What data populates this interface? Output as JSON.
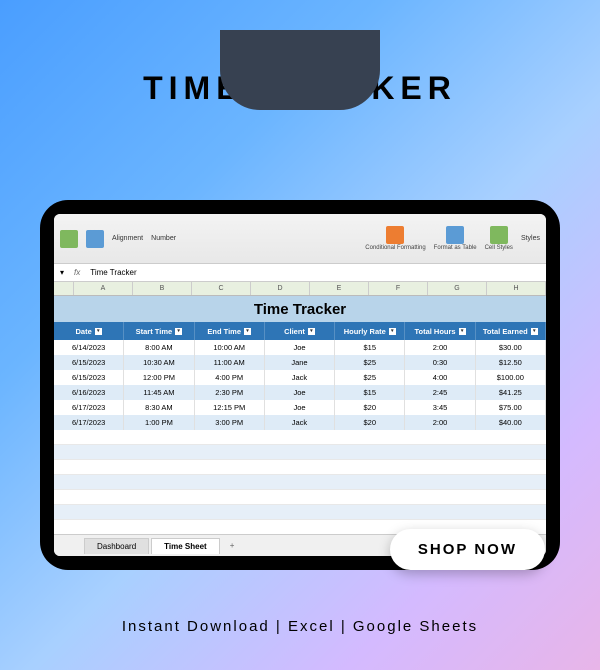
{
  "page": {
    "title": "TIME TRACKER",
    "cta": "SHOP NOW",
    "footer": "Instant Download | Excel | Google Sheets"
  },
  "ribbon": {
    "alignment": "Alignment",
    "number": "Number",
    "styles": "Styles",
    "conditional": "Conditional Formatting",
    "format_as": "Format as Table",
    "cell": "Cell Styles"
  },
  "formula": {
    "fx": "fx",
    "value": "Time Tracker"
  },
  "columns": [
    "A",
    "B",
    "C",
    "D",
    "E",
    "F",
    "G",
    "H"
  ],
  "sheet_title": "Time Tracker",
  "headers": [
    "Date",
    "Start Time",
    "End Time",
    "Client",
    "Hourly Rate",
    "Total Hours",
    "Total Earned"
  ],
  "rows": [
    {
      "date": "6/14/2023",
      "start": "8:00 AM",
      "end": "10:00 AM",
      "client": "Joe",
      "rate": "$15",
      "hours": "2:00",
      "earned": "$30.00"
    },
    {
      "date": "6/15/2023",
      "start": "10:30 AM",
      "end": "11:00 AM",
      "client": "Jane",
      "rate": "$25",
      "hours": "0:30",
      "earned": "$12.50"
    },
    {
      "date": "6/15/2023",
      "start": "12:00 PM",
      "end": "4:00 PM",
      "client": "Jack",
      "rate": "$25",
      "hours": "4:00",
      "earned": "$100.00"
    },
    {
      "date": "6/16/2023",
      "start": "11:45 AM",
      "end": "2:30 PM",
      "client": "Joe",
      "rate": "$15",
      "hours": "2:45",
      "earned": "$41.25"
    },
    {
      "date": "6/17/2023",
      "start": "8:30 AM",
      "end": "12:15 PM",
      "client": "Joe",
      "rate": "$20",
      "hours": "3:45",
      "earned": "$75.00"
    },
    {
      "date": "6/17/2023",
      "start": "1:00 PM",
      "end": "3:00 PM",
      "client": "Jack",
      "rate": "$20",
      "hours": "2:00",
      "earned": "$40.00"
    }
  ],
  "tabs": {
    "dashboard": "Dashboard",
    "timesheet": "Time Sheet",
    "add": "+"
  }
}
